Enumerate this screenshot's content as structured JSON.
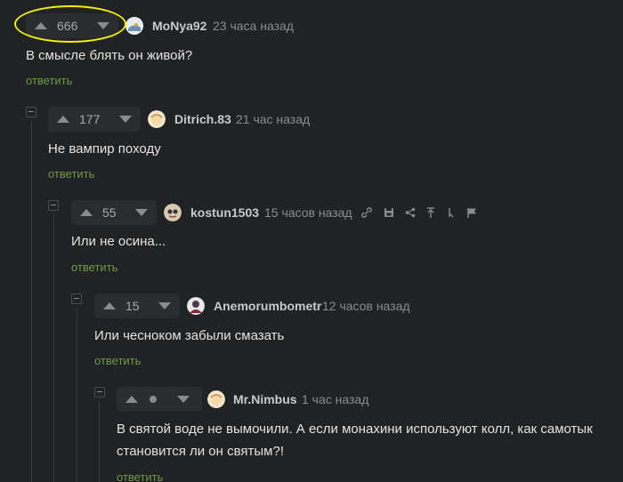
{
  "comments": [
    {
      "score": "666",
      "username": "MoNya92",
      "time": "23 часа назад",
      "text": "В смысле блять он живой?",
      "reply": "ответить"
    },
    {
      "score": "177",
      "username": "Ditrich.83",
      "time": "21 час назад",
      "text": "Не вампир походу",
      "reply": "ответить"
    },
    {
      "score": "55",
      "username": "kostun1503",
      "time": "15 часов назад",
      "text": "Или не осина...",
      "reply": "ответить"
    },
    {
      "score": "15",
      "username": "Anemorumbometr",
      "time": "12 часов назад",
      "text": "Или чесноком забыли смазать",
      "reply": "ответить"
    },
    {
      "username": "Mr.Nimbus",
      "time": "1 час назад",
      "text_line1": "В святой воде не вымочили. А если монахини используют колл, как самотык",
      "text_line2": "становится ли он святым?!",
      "reply": "ответить"
    }
  ],
  "colors": {
    "background": "#212223",
    "reply_link": "#6f9946",
    "highlight": "#f0f000"
  },
  "icons": [
    "link-icon",
    "save-icon",
    "share-icon",
    "top-icon",
    "branch-icon",
    "flag-icon"
  ]
}
